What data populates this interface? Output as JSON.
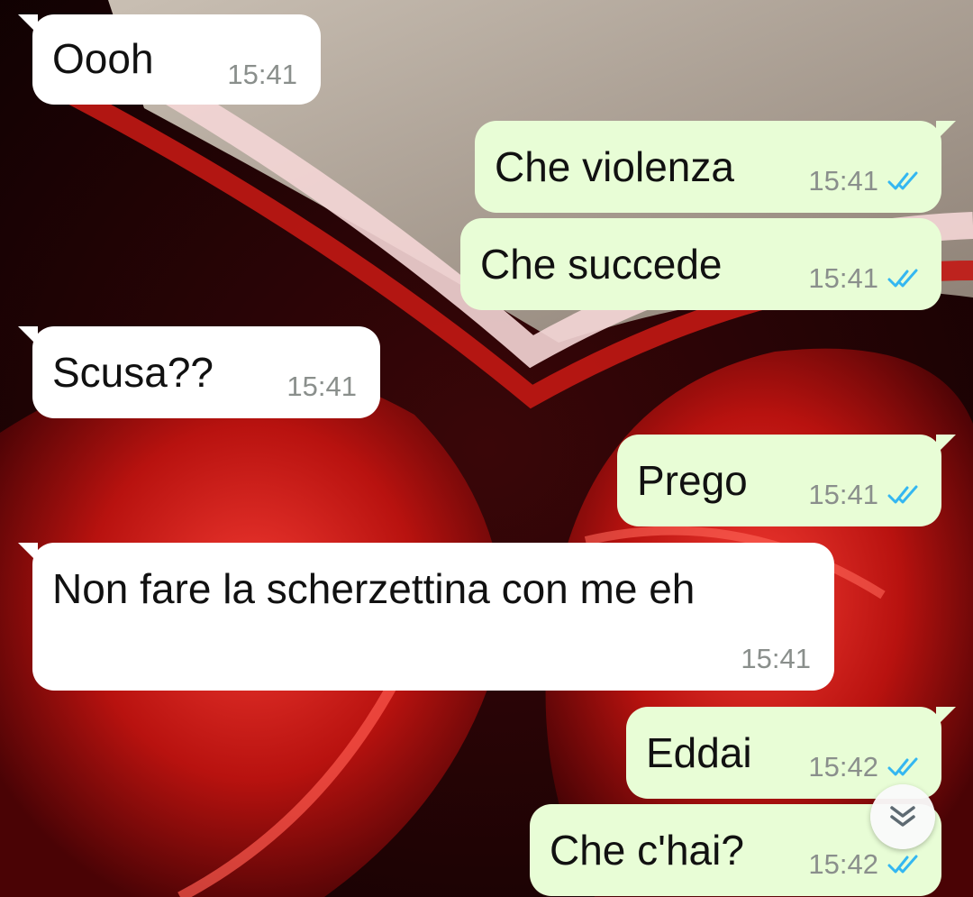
{
  "chat": {
    "messages": [
      {
        "direction": "incoming",
        "text": "Oooh",
        "time": "15:41"
      },
      {
        "direction": "outgoing",
        "text": "Che violenza",
        "time": "15:41",
        "status": "read"
      },
      {
        "direction": "outgoing",
        "text": "Che succede",
        "time": "15:41",
        "status": "read"
      },
      {
        "direction": "incoming",
        "text": "Scusa??",
        "time": "15:41"
      },
      {
        "direction": "outgoing",
        "text": "Prego",
        "time": "15:41",
        "status": "read"
      },
      {
        "direction": "incoming",
        "text": "Non fare la scherzettina con me eh",
        "time": "15:41"
      },
      {
        "direction": "outgoing",
        "text": "Eddai",
        "time": "15:42",
        "status": "read"
      },
      {
        "direction": "outgoing",
        "text": "Che c'hai?",
        "time": "15:42",
        "status": "read"
      }
    ]
  },
  "icons": {
    "read_receipt": "double-check-icon",
    "scroll_down": "double-chevron-down-icon"
  },
  "colors": {
    "incoming_bubble": "#ffffff",
    "outgoing_bubble": "#e8fdd6",
    "read_tick": "#34b7f1",
    "timestamp": "#8a8f8c"
  }
}
